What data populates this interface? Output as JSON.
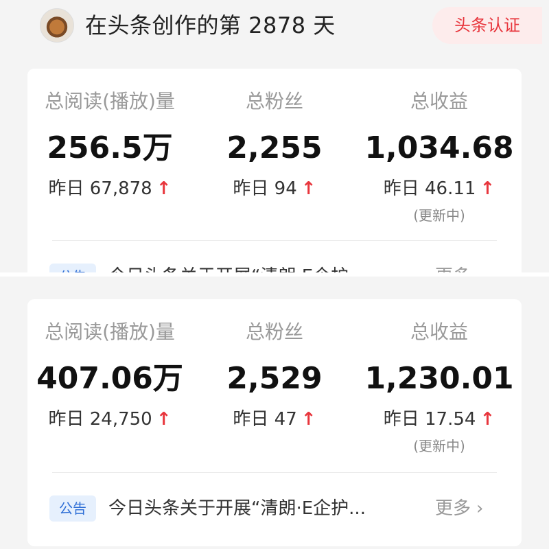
{
  "header": {
    "title": "在头条创作的第 2878 天",
    "badge": "头条认证"
  },
  "panels": [
    {
      "stats": [
        {
          "label": "总阅读(播放)量",
          "value": "256.5万",
          "delta": "昨日 67,878"
        },
        {
          "label": "总粉丝",
          "value": "2,255",
          "delta": "昨日 94"
        },
        {
          "label": "总收益",
          "value": "1,034.68",
          "delta": "昨日 46.11",
          "note": "(更新中)"
        }
      ],
      "notice": {
        "tag": "公告",
        "text": "今日头条关于开展“清朗·E企护",
        "more": "更多"
      }
    },
    {
      "stats": [
        {
          "label": "总阅读(播放)量",
          "value": "407.06万",
          "delta": "昨日 24,750"
        },
        {
          "label": "总粉丝",
          "value": "2,529",
          "delta": "昨日 47"
        },
        {
          "label": "总收益",
          "value": "1,230.01",
          "delta": "昨日 17.54",
          "note": "(更新中)"
        }
      ],
      "notice": {
        "tag": "公告",
        "text": "今日头条关于开展“清朗·E企护...",
        "more": "更多"
      }
    }
  ],
  "icons": {
    "up_arrow": "arrow-up-icon",
    "chevron": "chevron-right-icon",
    "avatar": "avatar"
  },
  "colors": {
    "accent_red": "#e8363d",
    "notice_blue": "#2f6fd6"
  }
}
